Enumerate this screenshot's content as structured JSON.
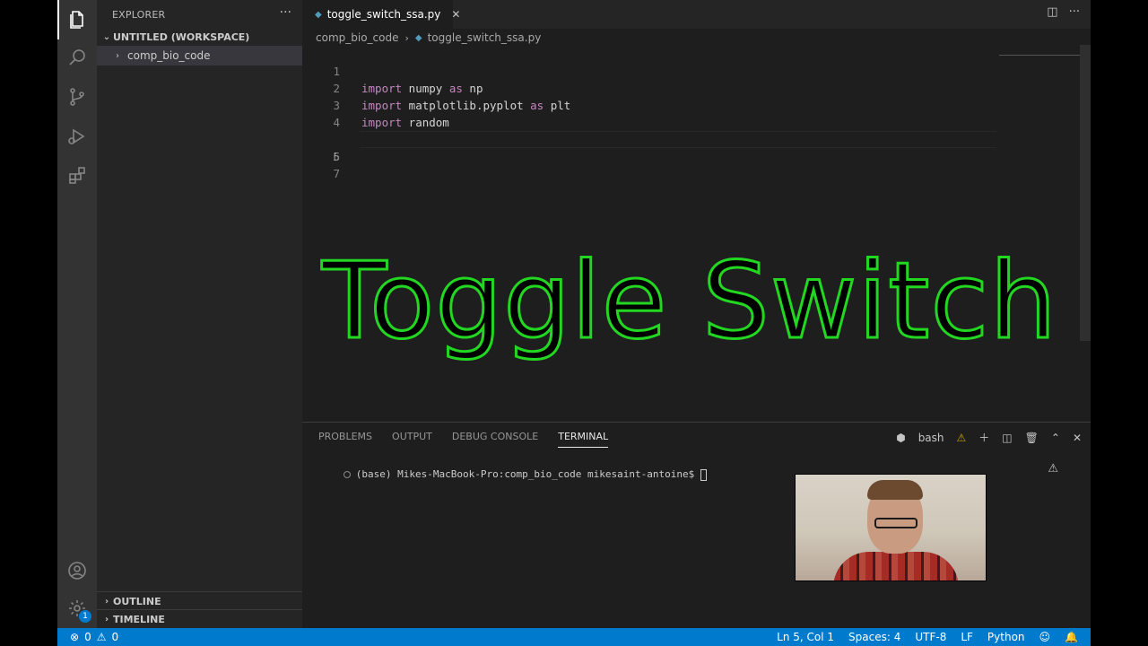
{
  "sidebar": {
    "title": "EXPLORER",
    "more": "···",
    "workspace": "UNTITLED (WORKSPACE)",
    "folder": "comp_bio_code",
    "outline": "OUTLINE",
    "timeline": "TIMELINE"
  },
  "activity": {
    "settings_badge": "1"
  },
  "editor": {
    "tab_label": "toggle_switch_ssa.py",
    "tab_close": "✕",
    "breadcrumb_folder": "comp_bio_code",
    "breadcrumb_file": "toggle_switch_ssa.py",
    "lines": [
      {
        "n": "1",
        "kw1": "import",
        "mod": " numpy ",
        "kw2": "as",
        "alias": " np"
      },
      {
        "n": "2",
        "kw1": "import",
        "mod": " matplotlib.pyplot ",
        "kw2": "as",
        "alias": " plt"
      },
      {
        "n": "3",
        "kw1": "import",
        "mod": " random",
        "kw2": "",
        "alias": ""
      },
      {
        "n": "4"
      },
      {
        "n": "5"
      },
      {
        "n": "6"
      },
      {
        "n": "7"
      }
    ]
  },
  "overlay": {
    "title": "Toggle Switch"
  },
  "panel": {
    "tabs": [
      "PROBLEMS",
      "OUTPUT",
      "DEBUG CONSOLE",
      "TERMINAL"
    ],
    "shell": "bash",
    "prompt": "(base) Mikes-MacBook-Pro:comp_bio_code mikesaint-antoine$ "
  },
  "status": {
    "errors": "0",
    "warnings": "0",
    "position": "Ln 5, Col 1",
    "spaces": "Spaces: 4",
    "encoding": "UTF-8",
    "eol": "LF",
    "language": "Python"
  },
  "colors": {
    "accent": "#007acc",
    "keyword": "#c586c0",
    "overlay_stroke": "#22d622"
  }
}
